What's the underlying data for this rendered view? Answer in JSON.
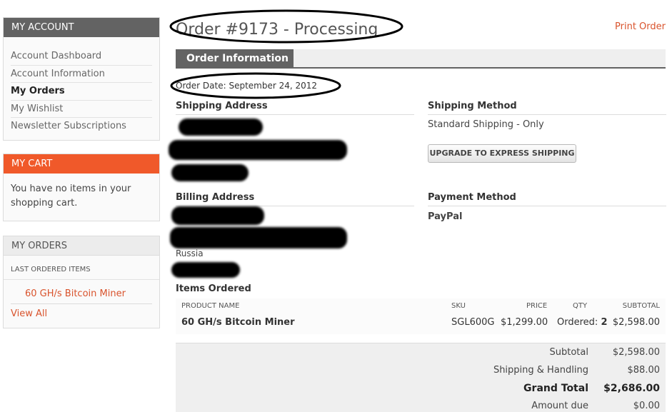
{
  "sidebar": {
    "account": {
      "title": "MY ACCOUNT",
      "items": [
        {
          "label": "Account Dashboard",
          "active": false
        },
        {
          "label": "Account Information",
          "active": false
        },
        {
          "label": "My Orders",
          "active": true
        },
        {
          "label": "My Wishlist",
          "active": false
        },
        {
          "label": "Newsletter Subscriptions",
          "active": false
        }
      ]
    },
    "cart": {
      "title": "MY CART",
      "message": "You have no items in your shopping cart."
    },
    "orders": {
      "title": "MY ORDERS",
      "subtitle": "LAST ORDERED ITEMS",
      "item": "60 GH/s Bitcoin Miner",
      "view_all": "View All"
    }
  },
  "main": {
    "title": "Order #9173 - Processing",
    "print_link": "Print Order",
    "tab": "Order Information",
    "order_date": "Order Date: September 24, 2012",
    "shipping_address_title": "Shipping Address",
    "shipping_method_title": "Shipping Method",
    "shipping_method": "Standard Shipping - Only",
    "upgrade_button": "UPGRADE TO EXPRESS SHIPPING",
    "billing_address_title": "Billing Address",
    "billing_country": "Russia",
    "payment_method_title": "Payment Method",
    "payment_method": "PayPal",
    "items_title": "Items Ordered",
    "items_table": {
      "headers": {
        "product": "PRODUCT NAME",
        "sku": "SKU",
        "price": "PRICE",
        "qty": "QTY",
        "subtotal": "SUBTOTAL"
      },
      "rows": [
        {
          "product": "60 GH/s Bitcoin Miner",
          "sku": "SGL600G",
          "price": "$1,299.00",
          "qty_label": "Ordered:",
          "qty": "2",
          "subtotal": "$2,598.00"
        }
      ]
    },
    "totals": [
      {
        "label": "Subtotal",
        "value": "$2,598.00"
      },
      {
        "label": "Shipping & Handling",
        "value": "$88.00"
      },
      {
        "label": "Grand Total",
        "value": "$2,686.00"
      },
      {
        "label": "Amount due",
        "value": "$0.00"
      }
    ]
  },
  "colors": {
    "accent": "#d9532c",
    "cart_header": "#f0592a",
    "dark_header": "#636363"
  }
}
